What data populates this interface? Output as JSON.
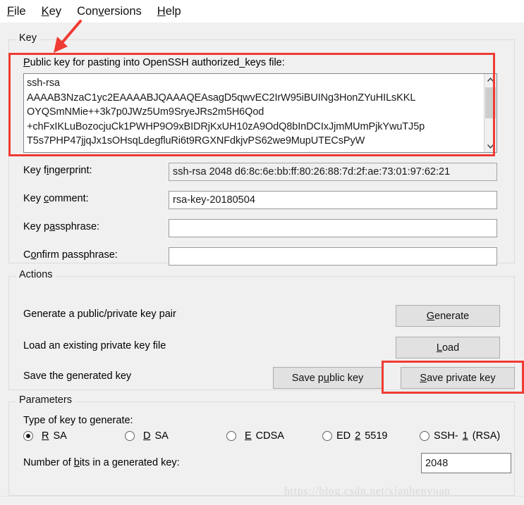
{
  "menu": {
    "items": [
      {
        "pre": "",
        "mnemonic": "F",
        "post": "ile"
      },
      {
        "pre": "",
        "mnemonic": "K",
        "post": "ey"
      },
      {
        "pre": "Con",
        "mnemonic": "v",
        "post": "ersions"
      },
      {
        "pre": "",
        "mnemonic": "H",
        "post": "elp"
      }
    ]
  },
  "key_group": {
    "title": "Key",
    "public_key_label_pre": "",
    "public_key_label_mnemonic": "P",
    "public_key_label_post": "ublic key for pasting into OpenSSH authorized_keys file:",
    "public_key_value": "ssh-rsa\nAAAAB3NzaC1yc2EAAAABJQAAAQEAsagD5qwvEC2IrW95iBUINg3HonZYuHILsKKL\nOYQSmNMie++3k7p0JWz5Um9SryeJRs2m5H6Qod\n+chFxIKLuBozocjuCk1PWHP9O9xBIDRjKxUH10zA9OdQ8bInDCIxJjmMUmPjkYwuTJ5p\nT5s7PHP47jjqJx1sOHsqLdegfluRi6t9RGXNFdkjvPS62we9MupUTECsPyW",
    "fields": [
      {
        "name": "key-fingerprint",
        "label_pre": "Key f",
        "label_mnemonic": "i",
        "label_post": "ngerprint:",
        "value": "ssh-rsa 2048 d6:8c:6e:bb:ff:80:26:88:7d:2f:ae:73:01:97:62:21",
        "readonly": true
      },
      {
        "name": "key-comment",
        "label_pre": "Key ",
        "label_mnemonic": "c",
        "label_post": "omment:",
        "value": "rsa-key-20180504",
        "readonly": false
      },
      {
        "name": "key-passphrase",
        "label_pre": "Key p",
        "label_mnemonic": "a",
        "label_post": "ssphrase:",
        "value": "",
        "readonly": false
      },
      {
        "name": "confirm-passphrase",
        "label_pre": "C",
        "label_mnemonic": "o",
        "label_post": "nfirm passphrase:",
        "value": "",
        "readonly": false
      }
    ],
    "scrollbar": {
      "up_icon": "chevron-up-icon",
      "down_icon": "chevron-down-icon"
    }
  },
  "actions_group": {
    "title": "Actions",
    "rows": [
      {
        "text": "Generate a public/private key pair",
        "buttons": [
          {
            "name": "generate-button",
            "pre": "",
            "mnemonic": "G",
            "post": "enerate"
          }
        ]
      },
      {
        "text": "Load an existing private key file",
        "buttons": [
          {
            "name": "load-button",
            "pre": "",
            "mnemonic": "L",
            "post": "oad"
          }
        ]
      },
      {
        "text": "Save the generated key",
        "buttons": [
          {
            "name": "save-public-key-button",
            "pre": "Save p",
            "mnemonic": "u",
            "post": "blic key"
          },
          {
            "name": "save-private-key-button",
            "pre": "",
            "mnemonic": "S",
            "post": "ave private key"
          }
        ]
      }
    ]
  },
  "params_group": {
    "title": "Parameters",
    "type_label": "Type of key to generate:",
    "key_types": [
      {
        "name": "radio-rsa",
        "pre": "",
        "mnemonic": "R",
        "post": "SA",
        "checked": true
      },
      {
        "name": "radio-dsa",
        "pre": "",
        "mnemonic": "D",
        "post": "SA",
        "checked": false
      },
      {
        "name": "radio-ecdsa",
        "pre": "",
        "mnemonic": "E",
        "post": "CDSA",
        "checked": false
      },
      {
        "name": "radio-ed25519",
        "pre": "ED",
        "mnemonic": "2",
        "post": "5519",
        "checked": false
      },
      {
        "name": "radio-ssh1-rsa",
        "pre": "SSH-",
        "mnemonic": "1",
        "post": " (RSA)",
        "checked": false
      }
    ],
    "bits_label_pre": "Number of ",
    "bits_label_mnemonic": "b",
    "bits_label_post": "its in a generated key:",
    "bits_value": "2048"
  },
  "annotations": {
    "color": "#ef3b33",
    "arrow_name": "red-annotation-arrow",
    "rects": [
      "public-key-area",
      "save-private-key-button"
    ]
  },
  "watermark": {
    "text": "https://blog.csdn.net/xianhenyuan"
  }
}
